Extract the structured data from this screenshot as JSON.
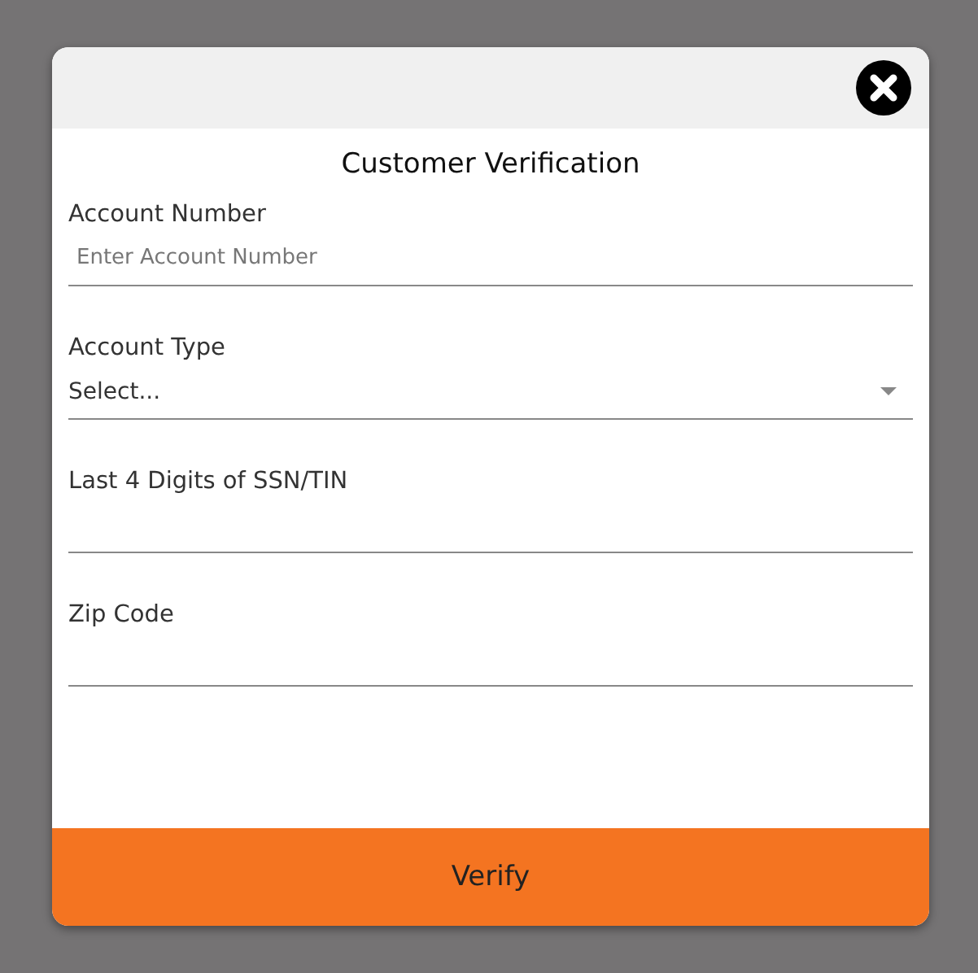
{
  "dialog": {
    "title": "Customer Verification",
    "fields": [
      {
        "kind": "text",
        "label": "Account Number",
        "placeholder": "Enter Account Number"
      },
      {
        "kind": "select",
        "label": "Account Type",
        "value": "Select..."
      },
      {
        "kind": "text",
        "label": "Last 4 Digits of SSN/TIN"
      },
      {
        "kind": "text",
        "label": "Zip Code"
      }
    ],
    "button": "Verify"
  }
}
